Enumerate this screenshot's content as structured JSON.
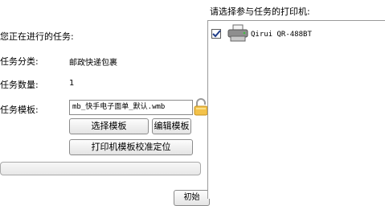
{
  "printer_section": {
    "heading": "请选择参与任务的打印机:",
    "printers": [
      {
        "name": "Qirui QR-488BT",
        "checked": true,
        "icon": "printer-icon"
      }
    ]
  },
  "task_section": {
    "heading": "您正在进行的任务:",
    "category_label": "任务分类:",
    "category_value": "邮政快递包裹",
    "quantity_label": "任务数量:",
    "quantity_value": "1",
    "template_label": "任务模板:",
    "template_value": "mb_快手电子面单_默认.wmb",
    "lock_icon": "lock-icon"
  },
  "buttons": {
    "select_template": "选择模板",
    "edit_template": "编辑模板",
    "calibrate": "打印机模板校准定位",
    "bottom_partial": "初始"
  },
  "progress": {
    "fraction": 0
  }
}
